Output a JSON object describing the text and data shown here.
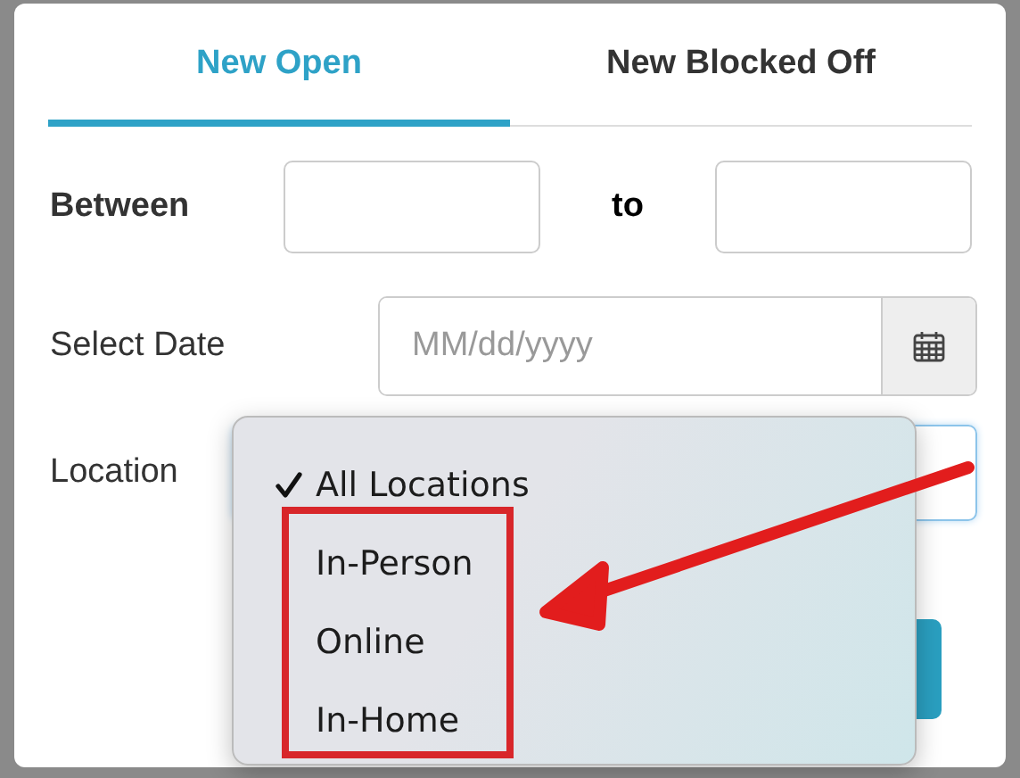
{
  "tabs": [
    {
      "label": "New Open",
      "selected": true
    },
    {
      "label": "New Blocked Off",
      "selected": false
    }
  ],
  "between": {
    "label": "Between",
    "to_label": "to"
  },
  "date": {
    "label": "Select Date",
    "placeholder": "MM/dd/yyyy"
  },
  "location": {
    "label": "Location",
    "options": [
      {
        "label": "All Locations",
        "checked": true
      },
      {
        "label": "In-Person",
        "checked": false
      },
      {
        "label": "Online",
        "checked": false
      },
      {
        "label": "In-Home",
        "checked": false
      }
    ]
  }
}
